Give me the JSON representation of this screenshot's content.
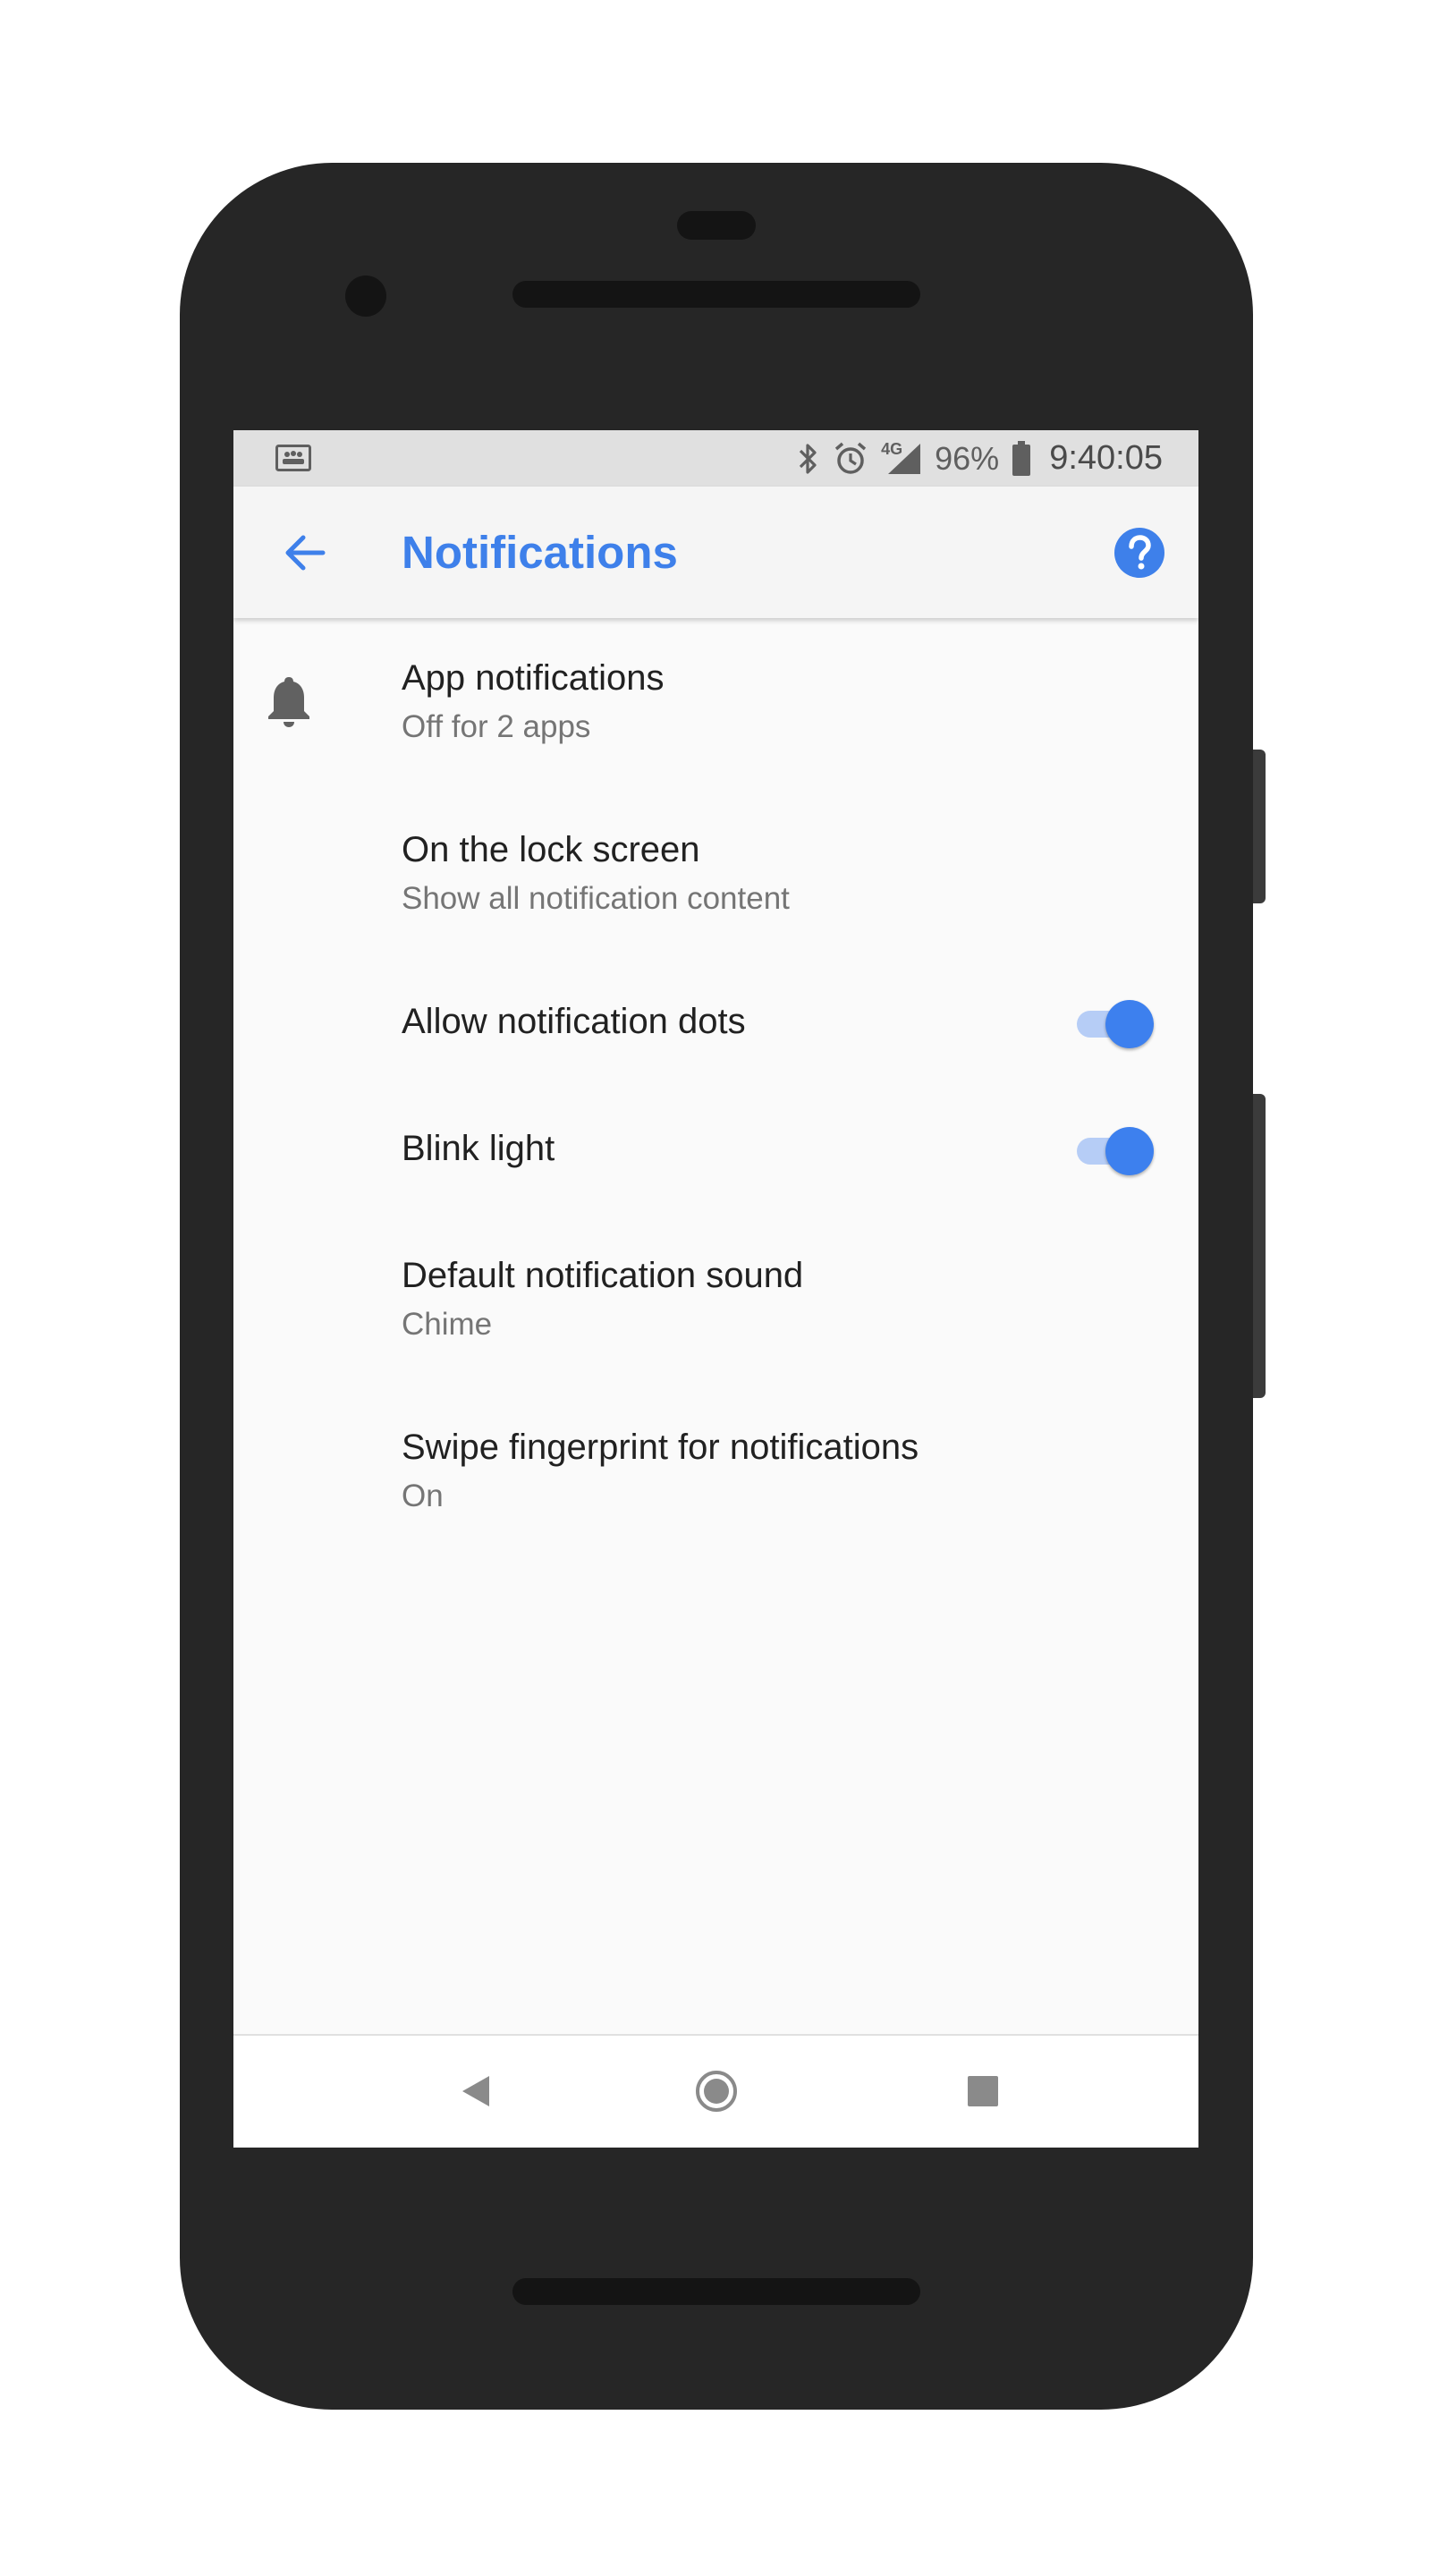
{
  "status_bar": {
    "left_icon": "gallery-notification-icon",
    "icons": [
      "bluetooth-icon",
      "alarm-icon",
      "signal-icon",
      "battery-icon"
    ],
    "network": "4G",
    "battery": "96%",
    "time": "9:40:05"
  },
  "app_bar": {
    "back_icon": "back-arrow-icon",
    "title": "Notifications",
    "help_icon": "help-icon"
  },
  "settings": [
    {
      "title": "App notifications",
      "subtitle": "Off for 2 apps",
      "icon": "bell-icon"
    },
    {
      "title": "On the lock screen",
      "subtitle": "Show all notification content"
    },
    {
      "title": "Allow notification dots",
      "toggle": true
    },
    {
      "title": "Blink light",
      "toggle": true
    },
    {
      "title": "Default notification sound",
      "subtitle": "Chime"
    },
    {
      "title": "Swipe fingerprint for notifications",
      "subtitle": "On"
    }
  ],
  "nav_bar": {
    "buttons": [
      "nav-back-icon",
      "nav-home-icon",
      "nav-recents-icon"
    ]
  },
  "colors": {
    "accent": "#3e80ea",
    "status_bar_bg": "#e0e0e0",
    "app_bar_bg": "#f5f5f5",
    "screen_bg": "#fafafa",
    "phone_body": "#262626"
  }
}
